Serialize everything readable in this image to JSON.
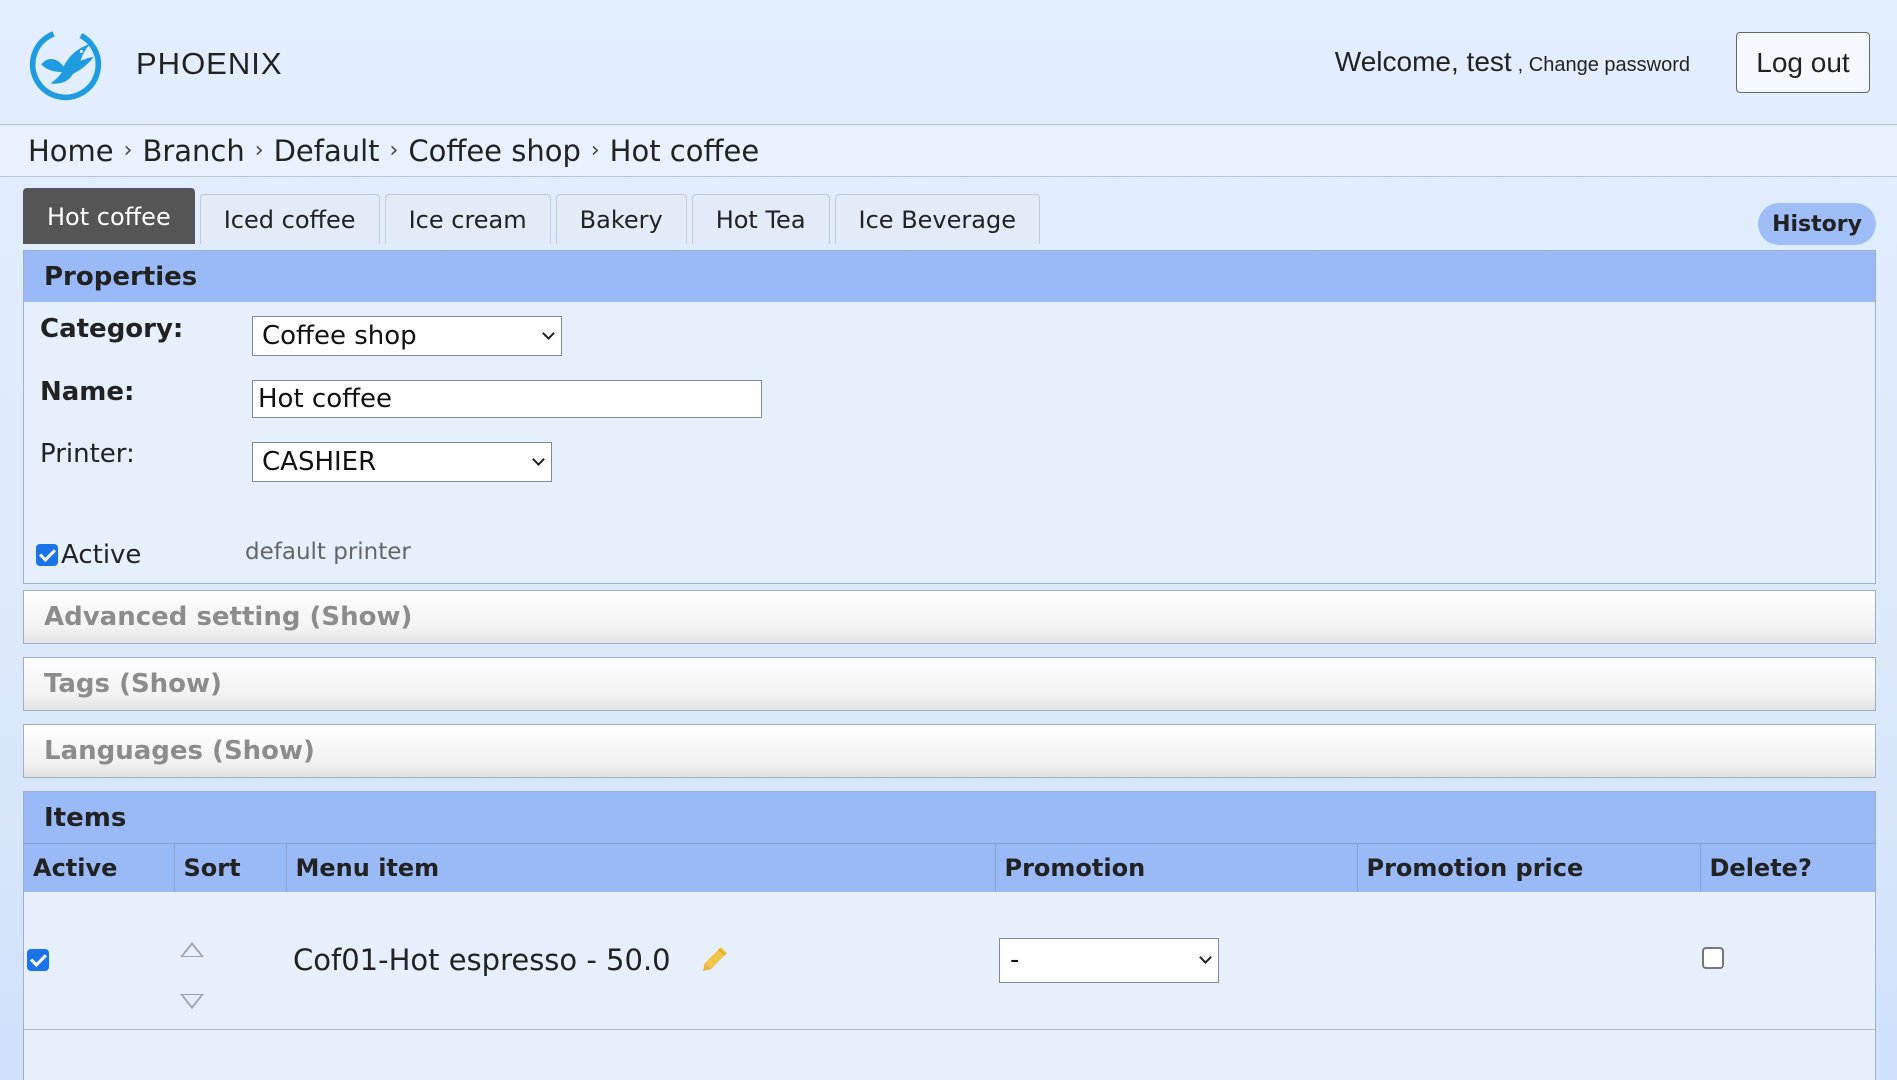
{
  "header": {
    "brand": "PHOENIX",
    "welcome": "Welcome, test",
    "change_password": ", Change password",
    "logout": "Log out",
    "logo_icon": "phoenix-bird-logo"
  },
  "breadcrumb": [
    "Home",
    "Branch",
    "Default",
    "Coffee shop",
    "Hot coffee"
  ],
  "breadcrumb_separator": "›",
  "tabs": [
    "Hot coffee",
    "Iced coffee",
    "Ice cream",
    "Bakery",
    "Hot Tea",
    "Ice Beverage"
  ],
  "active_tab": "Hot coffee",
  "history_label": "History",
  "properties": {
    "title": "Properties",
    "category_label": "Category:",
    "category_value": "Coffee shop",
    "name_label": "Name:",
    "name_value": "Hot coffee",
    "printer_label": "Printer:",
    "printer_value": "CASHIER",
    "printer_hint": "default printer",
    "active_label": "Active",
    "active_checked": true
  },
  "sections": {
    "advanced": "Advanced setting (Show)",
    "tags": "Tags (Show)",
    "languages": "Languages (Show)"
  },
  "items": {
    "title": "Items",
    "columns": [
      "Active",
      "Sort",
      "Menu item",
      "Promotion",
      "Promotion price",
      "Delete?"
    ],
    "rows": [
      {
        "active": true,
        "menu_item": "Cof01-Hot espresso - 50.0",
        "promotion": "-",
        "promotion_price": "",
        "delete": false
      }
    ]
  },
  "colors": {
    "header_bar": "#9ab9f7",
    "active_tab": "#555555",
    "checkbox": "#1a73e8",
    "pencil": "#f0c64a",
    "logo": "#1f9be0"
  }
}
